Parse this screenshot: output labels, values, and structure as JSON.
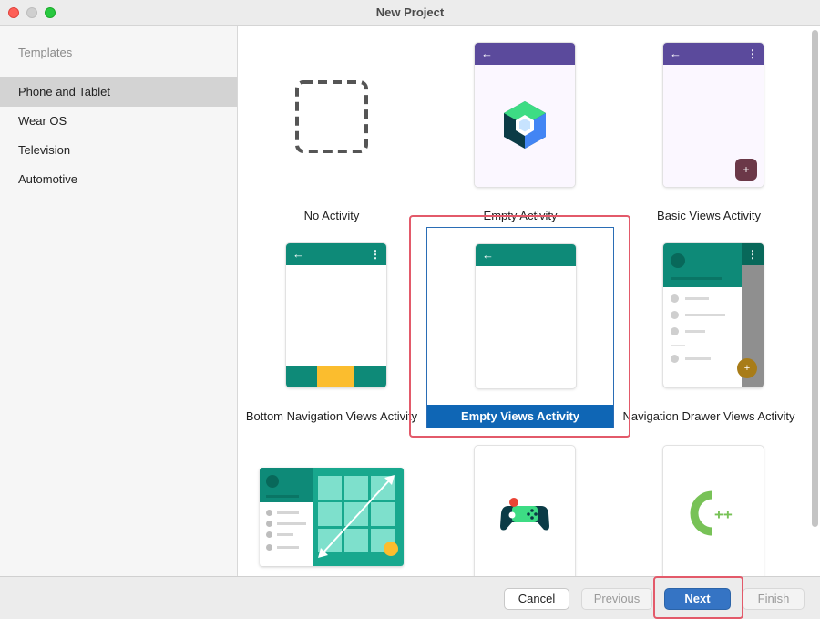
{
  "window": {
    "title": "New Project"
  },
  "sidebar": {
    "header": "Templates",
    "items": [
      {
        "label": "Phone and Tablet",
        "selected": true
      },
      {
        "label": "Wear OS"
      },
      {
        "label": "Television"
      },
      {
        "label": "Automotive"
      }
    ]
  },
  "templates": [
    {
      "label": "No Activity"
    },
    {
      "label": "Empty Activity"
    },
    {
      "label": "Basic Views Activity"
    },
    {
      "label": "Bottom Navigation Views Activity"
    },
    {
      "label": "Empty Views Activity",
      "selected": true
    },
    {
      "label": "Navigation Drawer Views Activity"
    }
  ],
  "footer": {
    "cancel": "Cancel",
    "previous": "Previous",
    "next": "Next",
    "finish": "Finish"
  },
  "colors": {
    "purple_appbar": "#5b4a9c",
    "teal_appbar": "#0e8a78",
    "dark_teal": "#08685a",
    "selection_blue": "#0f66b5",
    "highlight_red": "#e35a6a",
    "bottom_nav_yellow": "#fbbd2e",
    "fab_plum": "#6b3848"
  }
}
